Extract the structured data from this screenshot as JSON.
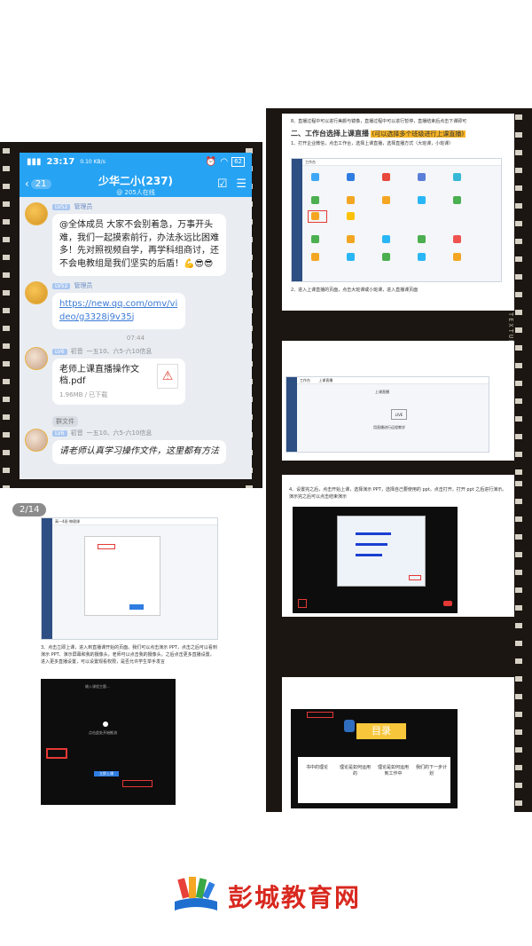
{
  "phone": {
    "status": {
      "time": "23:17",
      "speed": "0.10 KB/s",
      "battery": "62"
    },
    "back_count": "21",
    "group_name": "少华二小(237)",
    "online": "@ 205人在线",
    "messages": [
      {
        "level": "LV52",
        "role": "管理员",
        "text": "@全体成员 大家不会别着急，万事开头难，我们一起摸索前行，办法永远比困难多！先对照视频自学，再学科组商讨，还不会电教组是我们坚实的后盾！💪😎😎"
      },
      {
        "level": "LV52",
        "role": "管理员",
        "text": "https://new.qq.com/omv/video/g3328j9v35j"
      }
    ],
    "time_divider": "07:44",
    "file": {
      "level": "LV6",
      "sender": "初音",
      "meta": "一五10、六5-六10信息",
      "name": "老师上课直播操作文档.pdf",
      "size": "1.96MB / 已下载"
    },
    "chip": "群文件",
    "last": {
      "level": "LV6",
      "sender": "初音",
      "meta": "一五10、六5-六10信息",
      "text": "请老师认真学习操作文件，这里都有方法"
    }
  },
  "doc_top": {
    "step8": "8、直播过程中可以进行美颜与镜像，直播过程中可以进行暂停，直播结束后点击下课即可",
    "heading": "二、工作台选择上课直播",
    "heading_hl": "(可以选择多个班级进行上课直播)",
    "step1": "1、打开企业微信，点击工作台，选择上课直播，选择直播方式（大班课，小班课）",
    "step2": "2、进入上课直播的页面，点击大班课或小班课，进入直播课页面",
    "win1_title": "工作台",
    "win2_title": "工作台",
    "win2_tab": "上课直播",
    "win2_center": "上课直播",
    "win2_button": "LIVE",
    "win2_caption": "用直播进行远程教学"
  },
  "doc_bottom": {
    "step4": "4、设置完之后，点击开始上课，选择演示 PPT，选择自己要使用的 ppt。点击打开，打开 ppt 之后进行演示。演示完之后可以点击结束演示",
    "toc_title": "目录",
    "toc_items": [
      "书中的理论",
      "理论是如何运用的",
      "理论是如何运用到工作中",
      "我们的下一步计划"
    ]
  },
  "frame4": {
    "counter": "2/14",
    "window_title": "高一4班-物理课",
    "step3": "3、点击立即上课，进入到直播课开始的页面。我们可以点击演示 PPT，点击之后可以看到演示 PPT、演示屏幕和我的摄像头，老师可以点击我的摄像头，之后点击更多直播设置，进入更多直播设置，可以设置观看权限，是否允许学生举手发言",
    "live_title": "输入课程主题...",
    "live_center": "点击此处开始推流",
    "live_button": "立即上课"
  },
  "footer": {
    "site_name": "彭城教育网"
  },
  "colors": {
    "qq_blue": "#27a3f3",
    "film": "#1c1612",
    "highlight": "#f5b324",
    "logo_red": "#d8281f"
  }
}
